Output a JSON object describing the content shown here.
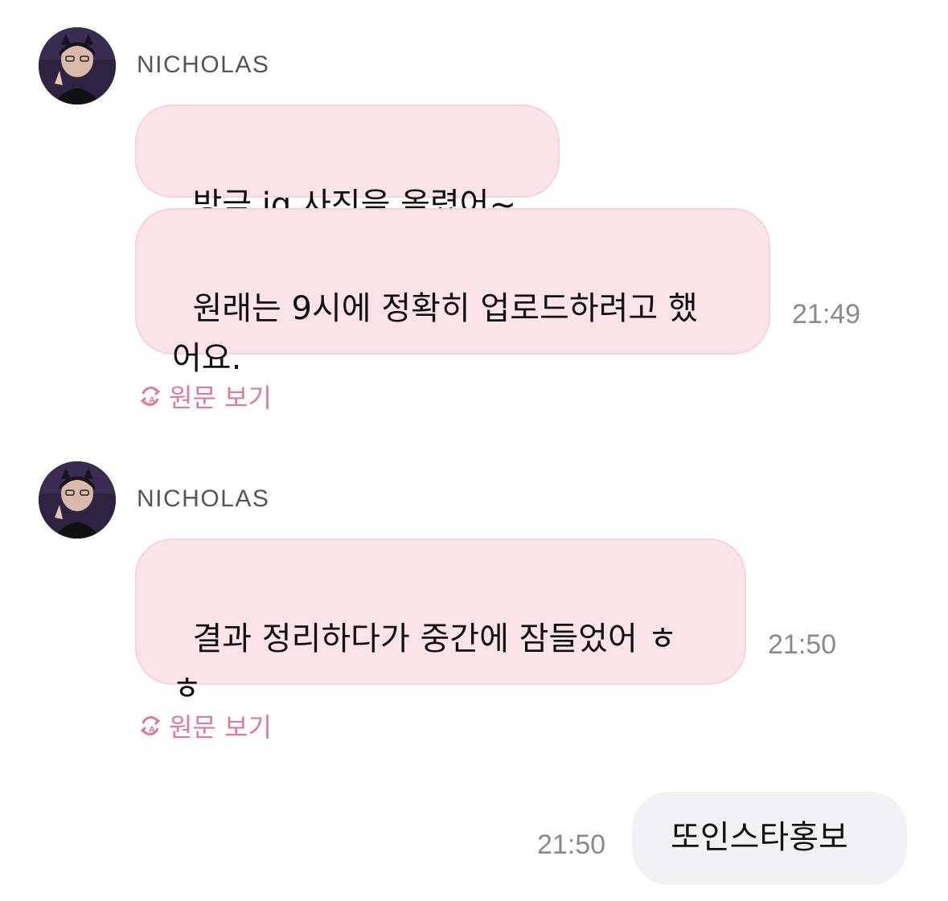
{
  "messages": [
    {
      "sender": "NICHOLAS",
      "bubbles": [
        {
          "text": "방금 ig 사진을 올렸어~"
        },
        {
          "text": "원래는 9시에 정확히 업로드하려고 했\n어요."
        }
      ],
      "time": "21:49",
      "view_original_label": "원문 보기"
    },
    {
      "sender": "NICHOLAS",
      "bubbles": [
        {
          "text": "결과 정리하다가 중간에 잠들었어 ㅎ\nㅎ"
        }
      ],
      "time": "21:50",
      "view_original_label": "원문 보기"
    }
  ],
  "my_message": {
    "text": "또인스타홍보",
    "time": "21:50"
  },
  "colors": {
    "received_bubble": "#fbe4e8",
    "sent_bubble": "#f1f2f6",
    "accent_pink": "#e07a9a",
    "timestamp": "#8a8a8a"
  },
  "icons": {
    "avatar": "user-avatar-photo",
    "translate": "translate-refresh-icon"
  }
}
